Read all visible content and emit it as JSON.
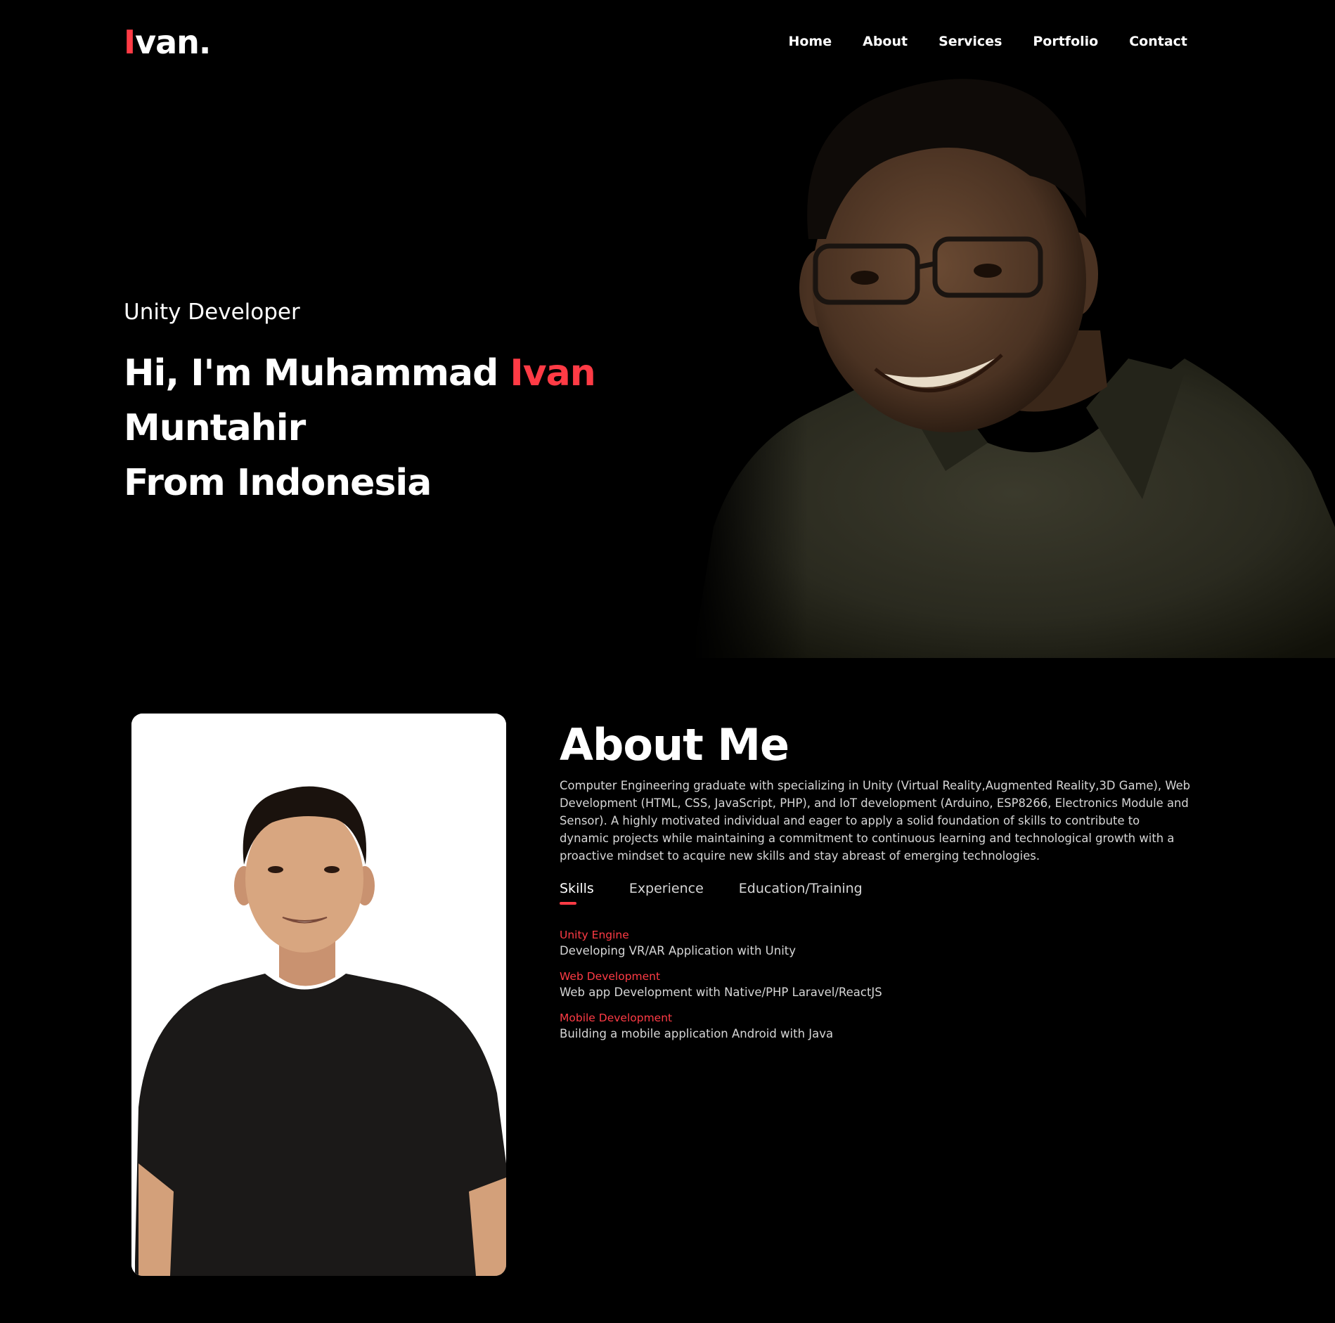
{
  "header": {
    "logo_first": "I",
    "logo_rest": "van.",
    "nav": [
      "Home",
      "About",
      "Services",
      "Portfolio",
      "Contact"
    ]
  },
  "hero": {
    "subtitle": "Unity Developer",
    "title_part1": "Hi, I'm Muhammad ",
    "title_accent": "Ivan",
    "title_part2": " Muntahir",
    "title_line2": "From Indonesia"
  },
  "about": {
    "heading": "About Me",
    "description": "Computer Engineering graduate with specializing in Unity (Virtual Reality,Augmented Reality,3D Game), Web Development (HTML, CSS, JavaScript, PHP), and IoT development (Arduino, ESP8266, Electronics Module and Sensor). A highly motivated individual and eager to apply a solid foundation of skills to contribute to dynamic projects while maintaining a commitment to continuous learning and technological growth with a proactive mindset to acquire new skills and stay abreast of emerging technologies.",
    "tabs": [
      "Skills",
      "Experience",
      "Education/Training"
    ],
    "active_tab": "Skills",
    "skills": [
      {
        "title": "Unity Engine",
        "desc": "Developing VR/AR Application with Unity"
      },
      {
        "title": "Web Development",
        "desc": "Web app Development with Native/PHP Laravel/ReactJS"
      },
      {
        "title": "Mobile Development",
        "desc": "Building a mobile application Android with Java"
      }
    ]
  },
  "colors": {
    "background": "#000000",
    "accent": "#ff3b45",
    "text": "#ffffff",
    "muted_text": "#d6d6d6",
    "photo_card": "#ffffff"
  }
}
